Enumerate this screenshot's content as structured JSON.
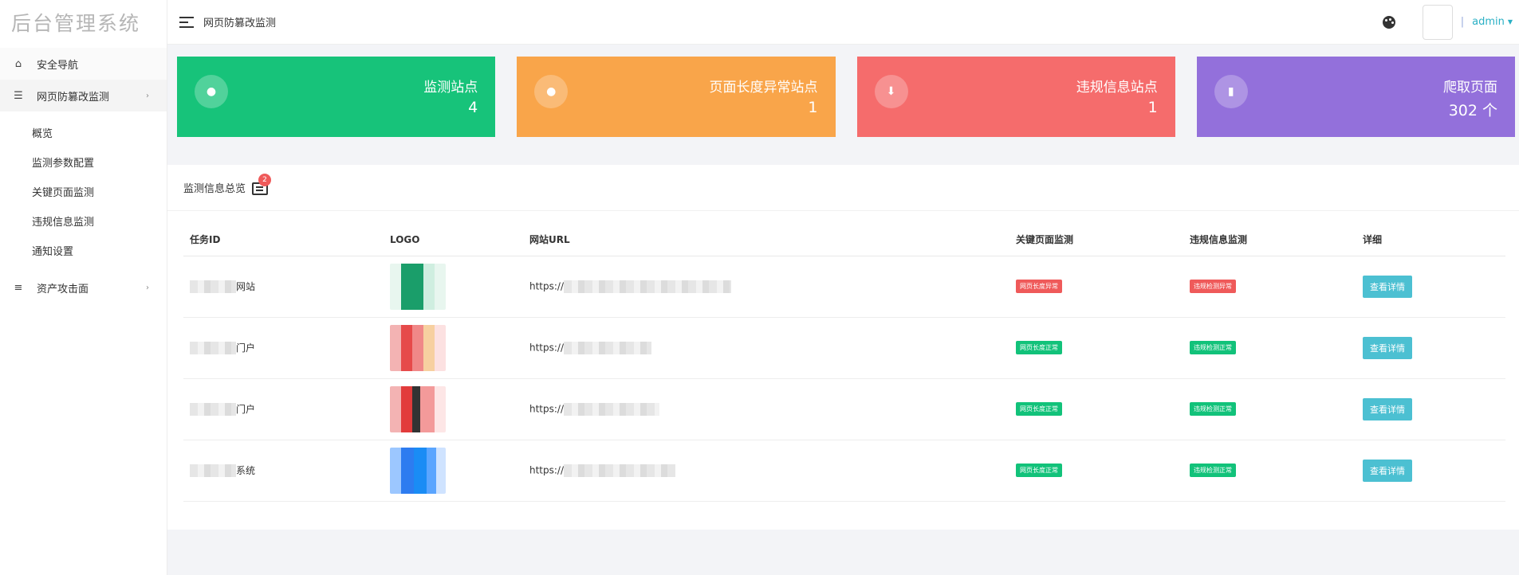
{
  "brand": "后台管理系统",
  "topbar": {
    "title": "网页防篡改监测",
    "user": "admin"
  },
  "sidebar": {
    "items": [
      {
        "label": "安全导航",
        "icon": "home-icon"
      },
      {
        "label": "网页防篡改监测",
        "icon": "list-icon",
        "expanded": true
      },
      {
        "label": "资产攻击面",
        "icon": "menu-icon"
      }
    ],
    "sub_items": [
      "概览",
      "监测参数配置",
      "关键页面监测",
      "违规信息监测",
      "通知设置"
    ]
  },
  "cards": [
    {
      "label": "监测站点",
      "value": "4",
      "color": "#17c37a",
      "icon": "user-icon"
    },
    {
      "label": "页面长度异常站点",
      "value": "1",
      "color": "#f9a54a",
      "icon": "user-icon"
    },
    {
      "label": "违规信息站点",
      "value": "1",
      "color": "#f56c6c",
      "icon": "download-icon"
    },
    {
      "label": "爬取页面",
      "value": "302 个",
      "color": "#9370db",
      "icon": "clipboard-icon"
    }
  ],
  "panel": {
    "title": "监测信息总览",
    "badge": "2",
    "columns": [
      "任务ID",
      "LOGO",
      "网站URL",
      "关键页面监测",
      "违规信息监测",
      "详细"
    ],
    "rows": [
      {
        "id_suffix": "网站",
        "url_prefix": "https://",
        "key": "网页长度异常",
        "key_ok": false,
        "vio": "违规检测异常",
        "vio_ok": false,
        "action": "查看详情"
      },
      {
        "id_suffix": "门户",
        "url_prefix": "https://",
        "key": "网页长度正常",
        "key_ok": true,
        "vio": "违规检测正常",
        "vio_ok": true,
        "action": "查看详情"
      },
      {
        "id_suffix": "门户",
        "url_prefix": "https://",
        "key": "网页长度正常",
        "key_ok": true,
        "vio": "违规检测正常",
        "vio_ok": true,
        "action": "查看详情"
      },
      {
        "id_suffix": "系统",
        "url_prefix": "https://",
        "key": "网页长度正常",
        "key_ok": true,
        "vio": "违规检测正常",
        "vio_ok": true,
        "action": "查看详情"
      }
    ]
  },
  "colors": {
    "accent": "#2ab0c5",
    "ok": "#12c27a",
    "bad": "#ef5a5a",
    "button": "#4cc0d2"
  }
}
